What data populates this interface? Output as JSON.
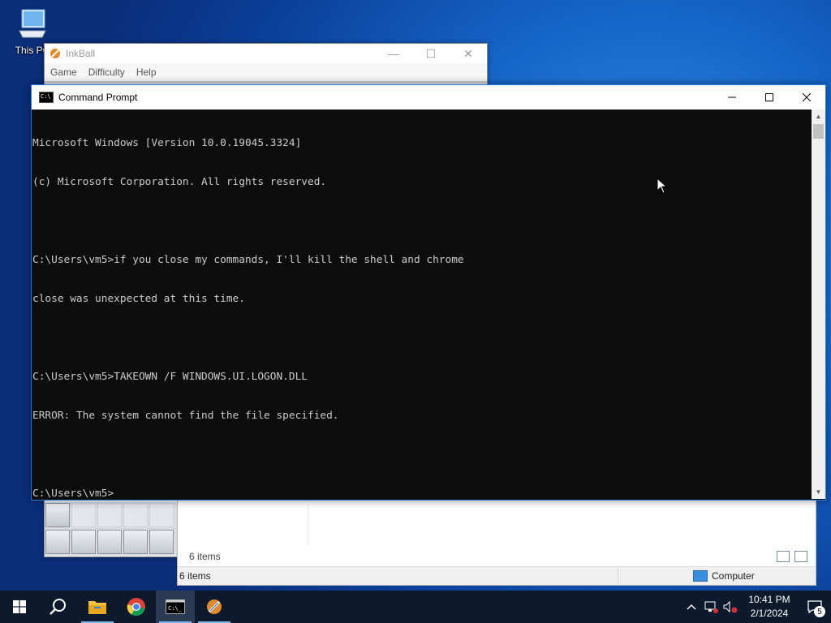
{
  "desktop": {
    "icons": [
      {
        "label": "This PC",
        "icon": "this-pc-icon"
      }
    ]
  },
  "inkball": {
    "title": "InkBall",
    "menu": [
      "Game",
      "Difficulty",
      "Help"
    ],
    "controls": {
      "minimize": "—",
      "maximize": "☐",
      "close": "✕"
    }
  },
  "explorer": {
    "items_label": "6 items",
    "status_items": "6 items",
    "status_location": "Computer"
  },
  "cmd": {
    "title": "Command Prompt",
    "controls": {
      "minimize": "—",
      "maximize": "☐",
      "close": "✕"
    },
    "lines": [
      "Microsoft Windows [Version 10.0.19045.3324]",
      "(c) Microsoft Corporation. All rights reserved.",
      "",
      "C:\\Users\\vm5>if you close my commands, I'll kill the shell and chrome",
      "close was unexpected at this time.",
      "",
      "C:\\Users\\vm5>TAKEOWN /F WINDOWS.UI.LOGON.DLL",
      "ERROR: The system cannot find the file specified.",
      "",
      "C:\\Users\\vm5>"
    ]
  },
  "taskbar": {
    "apps": [
      {
        "name": "start-button",
        "icon": "windows-icon"
      },
      {
        "name": "search-button",
        "icon": "search-icon"
      },
      {
        "name": "file-explorer-button",
        "icon": "folder-icon"
      },
      {
        "name": "chrome-button",
        "icon": "chrome-icon"
      },
      {
        "name": "command-prompt-button",
        "icon": "cmd-icon",
        "active": true
      },
      {
        "name": "inkball-button",
        "icon": "inkball-icon"
      }
    ],
    "tray": {
      "time": "10:41 PM",
      "date": "2/1/2024",
      "notifications_count": "5"
    }
  }
}
